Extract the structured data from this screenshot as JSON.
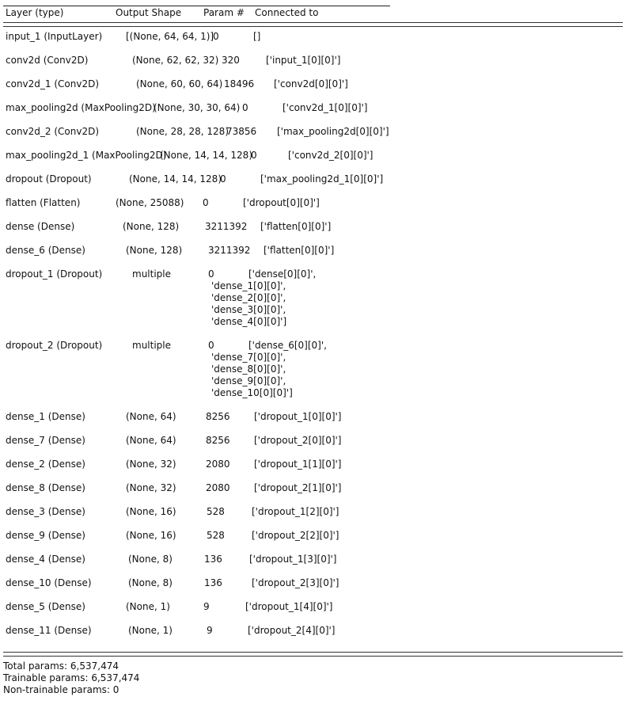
{
  "header": {
    "layer": "Layer (type)",
    "shape": "Output Shape",
    "param": "Param #",
    "connected": "Connected to"
  },
  "rows": [
    {
      "layer": "input_1 (InputLayer)",
      "shape": "[(None, 64, 64, 1)]",
      "param": "0",
      "connected": [
        "[]"
      ]
    },
    {
      "layer": "conv2d (Conv2D)",
      "shape": "(None, 62, 62, 32)",
      "param": "320",
      "connected": [
        "['input_1[0][0]']"
      ]
    },
    {
      "layer": "conv2d_1 (Conv2D)",
      "shape": "(None, 60, 60, 64)",
      "param": "18496",
      "connected": [
        "['conv2d[0][0]']"
      ]
    },
    {
      "layer": "max_pooling2d (MaxPooling2D)",
      "shape": "(None, 30, 30, 64)",
      "param": "0",
      "connected": [
        "['conv2d_1[0][0]']"
      ]
    },
    {
      "layer": "conv2d_2 (Conv2D)",
      "shape": "(None, 28, 28, 128)",
      "param": "73856",
      "connected": [
        "['max_pooling2d[0][0]']"
      ]
    },
    {
      "layer": "max_pooling2d_1 (MaxPooling2D)",
      "shape": "(None, 14, 14, 128)",
      "param": "0",
      "connected": [
        "['conv2d_2[0][0]']"
      ]
    },
    {
      "layer": "dropout (Dropout)",
      "shape": "(None, 14, 14, 128)",
      "param": "0",
      "connected": [
        "['max_pooling2d_1[0][0]']"
      ]
    },
    {
      "layer": "flatten (Flatten)",
      "shape": "(None, 25088)",
      "param": "0",
      "connected": [
        "['dropout[0][0]']"
      ]
    },
    {
      "layer": "dense (Dense)",
      "shape": "(None, 128)",
      "param": "3211392",
      "connected": [
        "['flatten[0][0]']"
      ]
    },
    {
      "layer": "dense_6 (Dense)",
      "shape": "(None, 128)",
      "param": "3211392",
      "connected": [
        "['flatten[0][0]']"
      ]
    },
    {
      "layer": "dropout_1 (Dropout)",
      "shape": "multiple",
      "param": "0",
      "connected": [
        "['dense[0][0]',",
        "'dense_1[0][0]',",
        "'dense_2[0][0]',",
        "'dense_3[0][0]',",
        "'dense_4[0][0]']"
      ]
    },
    {
      "layer": "dropout_2 (Dropout)",
      "shape": "multiple",
      "param": "0",
      "connected": [
        "['dense_6[0][0]',",
        "'dense_7[0][0]',",
        "'dense_8[0][0]',",
        "'dense_9[0][0]',",
        "'dense_10[0][0]']"
      ]
    },
    {
      "layer": "dense_1 (Dense)",
      "shape": "(None, 64)",
      "param": "8256",
      "connected": [
        "['dropout_1[0][0]']"
      ]
    },
    {
      "layer": "dense_7 (Dense)",
      "shape": "(None, 64)",
      "param": "8256",
      "connected": [
        "['dropout_2[0][0]']"
      ]
    },
    {
      "layer": "dense_2 (Dense)",
      "shape": "(None, 32)",
      "param": "2080",
      "connected": [
        "['dropout_1[1][0]']"
      ]
    },
    {
      "layer": "dense_8 (Dense)",
      "shape": "(None, 32)",
      "param": "2080",
      "connected": [
        "['dropout_2[1][0]']"
      ]
    },
    {
      "layer": "dense_3 (Dense)",
      "shape": "(None, 16)",
      "param": "528",
      "connected": [
        "['dropout_1[2][0]']"
      ]
    },
    {
      "layer": "dense_9 (Dense)",
      "shape": "(None, 16)",
      "param": "528",
      "connected": [
        "['dropout_2[2][0]']"
      ]
    },
    {
      "layer": "dense_4 (Dense)",
      "shape": "(None, 8)",
      "param": "136",
      "connected": [
        "['dropout_1[3][0]']"
      ]
    },
    {
      "layer": "dense_10 (Dense)",
      "shape": "(None, 8)",
      "param": "136",
      "connected": [
        "['dropout_2[3][0]']"
      ]
    },
    {
      "layer": "dense_5 (Dense)",
      "shape": "(None, 1)",
      "param": "9",
      "connected": [
        "['dropout_1[4][0]']"
      ]
    },
    {
      "layer": "dense_11 (Dense)",
      "shape": "(None, 1)",
      "param": "9",
      "connected": [
        "['dropout_2[4][0]']"
      ]
    }
  ],
  "totals": {
    "total": "Total params: 6,537,474",
    "trainable": "Trainable params: 6,537,474",
    "non_trainable": "Non-trainable params: 0"
  }
}
